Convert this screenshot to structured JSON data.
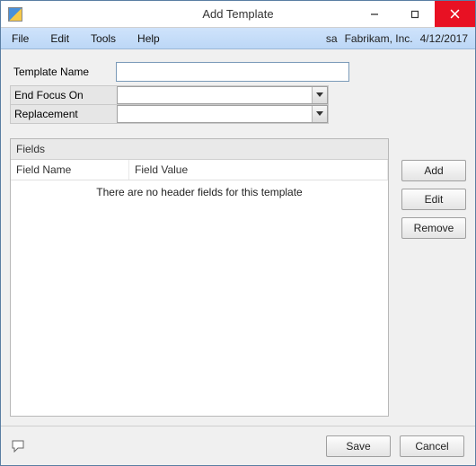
{
  "window": {
    "title": "Add Template"
  },
  "menu": {
    "file": "File",
    "edit": "Edit",
    "tools": "Tools",
    "help": "Help",
    "user": "sa",
    "company": "Fabrikam, Inc.",
    "date": "4/12/2017"
  },
  "form": {
    "template_name_label": "Template Name",
    "template_name_value": "",
    "end_focus_label": "End Focus On",
    "end_focus_value": "",
    "replacement_label": "Replacement",
    "replacement_value": ""
  },
  "fields": {
    "panel_title": "Fields",
    "col_name": "Field Name",
    "col_value": "Field Value",
    "empty_message": "There are no header fields for this template",
    "rows": []
  },
  "buttons": {
    "add": "Add",
    "edit": "Edit",
    "remove": "Remove",
    "save": "Save",
    "cancel": "Cancel"
  }
}
